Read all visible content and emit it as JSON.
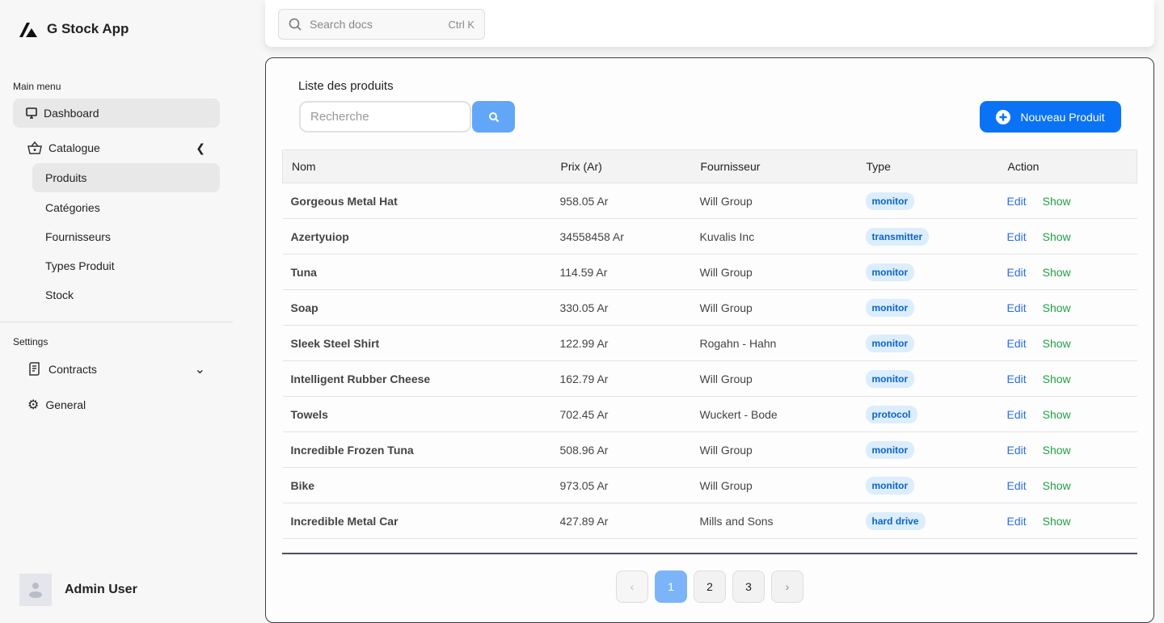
{
  "app": {
    "title": "G Stock App"
  },
  "sidebar": {
    "main_label": "Main menu",
    "dashboard": "Dashboard",
    "catalogue": "Catalogue",
    "sub": [
      "Produits",
      "Catégories",
      "Fournisseurs",
      "Types Produit",
      "Stock"
    ],
    "settings_label": "Settings",
    "contracts": "Contracts",
    "general": "General",
    "user": "Admin User"
  },
  "topbar": {
    "search_placeholder": "Search docs",
    "shortcut": "Ctrl K"
  },
  "main": {
    "title": "Liste des produits",
    "search_placeholder": "Recherche",
    "new_button": "Nouveau Produit",
    "columns": [
      "Nom",
      "Prix (Ar)",
      "Fournisseur",
      "Type",
      "Action"
    ],
    "rows": [
      {
        "nom": "Gorgeous Metal Hat",
        "prix": "958.05 Ar",
        "fournisseur": "Will Group",
        "type": "monitor"
      },
      {
        "nom": "Azertyuiop",
        "prix": "34558458 Ar",
        "fournisseur": "Kuvalis Inc",
        "type": "transmitter"
      },
      {
        "nom": "Tuna",
        "prix": "114.59 Ar",
        "fournisseur": "Will Group",
        "type": "monitor"
      },
      {
        "nom": "Soap",
        "prix": "330.05 Ar",
        "fournisseur": "Will Group",
        "type": "monitor"
      },
      {
        "nom": "Sleek Steel Shirt",
        "prix": "122.99 Ar",
        "fournisseur": "Rogahn - Hahn",
        "type": "monitor"
      },
      {
        "nom": "Intelligent Rubber Cheese",
        "prix": "162.79 Ar",
        "fournisseur": "Will Group",
        "type": "monitor"
      },
      {
        "nom": "Towels",
        "prix": "702.45 Ar",
        "fournisseur": "Wuckert - Bode",
        "type": "protocol"
      },
      {
        "nom": "Incredible Frozen Tuna",
        "prix": "508.96 Ar",
        "fournisseur": "Will Group",
        "type": "monitor"
      },
      {
        "nom": "Bike",
        "prix": "973.05 Ar",
        "fournisseur": "Will Group",
        "type": "monitor"
      },
      {
        "nom": "Incredible Metal Car",
        "prix": "427.89 Ar",
        "fournisseur": "Mills and Sons",
        "type": "hard drive"
      }
    ],
    "edit_label": "Edit",
    "show_label": "Show",
    "pagination": {
      "prev": "‹",
      "pages": [
        "1",
        "2",
        "3"
      ],
      "current": "1",
      "next": "›"
    }
  }
}
